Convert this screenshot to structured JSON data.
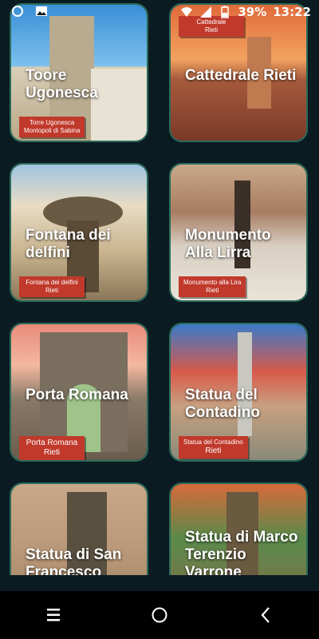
{
  "status": {
    "battery": "39%",
    "time": "13:22"
  },
  "cards": [
    {
      "title": "Toore Ugonesca",
      "tag_line1": "Torre Ugonesca",
      "tag_line2": "Montopoli di Sabina"
    },
    {
      "title": "Cattedrale Rieti",
      "tag_line1": "Cattedrale",
      "tag_line2": "Rieti"
    },
    {
      "title": "Fontana dei delfini",
      "tag_line1": "Fontana dei delfini",
      "tag_line2": "Rieti"
    },
    {
      "title": "Monumento Alla Lirra",
      "tag_line1": "Monumento alla Lira",
      "tag_line2": "Rieti"
    },
    {
      "title": "Porta Romana",
      "tag_line1": "Porta Romana",
      "tag_line2": "Rieti"
    },
    {
      "title": "Statua del Contadino",
      "tag_line1": "Statua del Contadino",
      "tag_line2": "Rieti"
    },
    {
      "title": "Statua di San Francesco",
      "tag_line1": "",
      "tag_line2": ""
    },
    {
      "title": "Statua di Marco Terenzio Varrone",
      "tag_line1": "",
      "tag_line2": ""
    }
  ],
  "colors": {
    "background": "#0b1b22",
    "tag": "#c0392b",
    "card_border": "#2a6b5a"
  }
}
